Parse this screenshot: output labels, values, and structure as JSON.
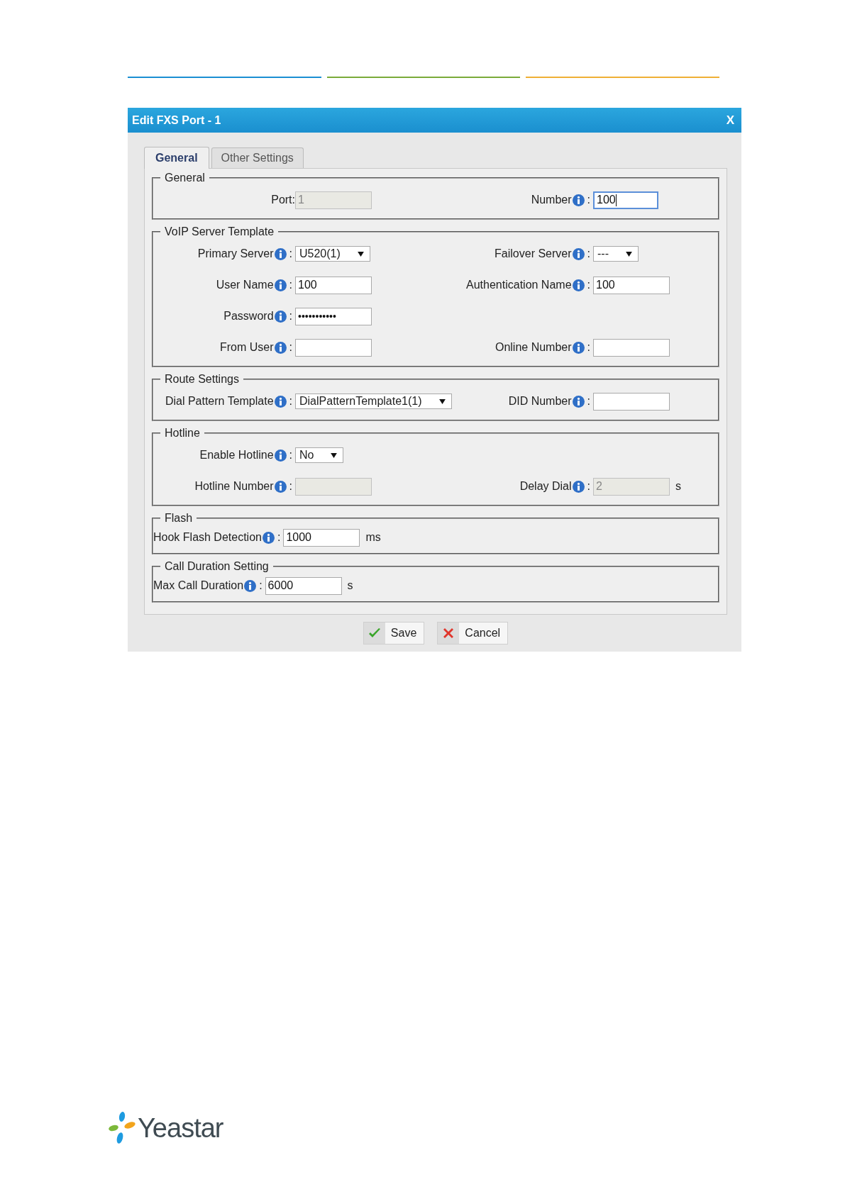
{
  "header_rules": [
    {
      "color": "#1b8fd2"
    },
    {
      "color": "#7aab3a"
    },
    {
      "color": "#efb035"
    }
  ],
  "dialog": {
    "title": "Edit FXS Port - 1",
    "close": "X",
    "tabs": [
      {
        "label": "General",
        "selected": true
      },
      {
        "label": "Other Settings",
        "selected": false
      }
    ],
    "sections": [
      {
        "title": "General",
        "compact": false,
        "rows": [
          [
            {
              "label": "Port:",
              "info": false,
              "kind": "input",
              "value": "1",
              "disabled": true,
              "focused": false
            },
            {
              "label": "Number",
              "info": true,
              "sep": ":",
              "kind": "input",
              "value": "100",
              "disabled": false,
              "focused": true
            }
          ]
        ]
      },
      {
        "title": "VoIP Server Template",
        "compact": false,
        "rows": [
          [
            {
              "label": "Primary Server",
              "info": true,
              "sep": ":",
              "kind": "select",
              "value": "U520(1)",
              "disabled": false,
              "focused": false
            },
            {
              "label": "Failover Server",
              "info": true,
              "sep": ":",
              "kind": "select",
              "value": "---",
              "disabled": false,
              "focused": false
            }
          ],
          [
            {
              "label": "User Name",
              "info": true,
              "sep": ":",
              "kind": "input",
              "value": "100",
              "disabled": false,
              "focused": false
            },
            {
              "label": "Authentication Name",
              "info": true,
              "sep": ":",
              "kind": "input",
              "value": "100",
              "disabled": false,
              "focused": false
            }
          ],
          [
            {
              "label": "Password",
              "info": true,
              "sep": ":",
              "kind": "password",
              "value": "•••••••••••",
              "disabled": false,
              "focused": false
            }
          ],
          [
            {
              "label": "From User",
              "info": true,
              "sep": ":",
              "kind": "input",
              "disabled": false,
              "focused": false
            },
            {
              "label": "Online Number",
              "info": true,
              "sep": ":",
              "kind": "input",
              "disabled": false,
              "focused": false
            }
          ]
        ]
      },
      {
        "title": "Route Settings",
        "compact": false,
        "rows": [
          [
            {
              "label": "Dial Pattern Template",
              "info": true,
              "sep": ":",
              "kind": "select",
              "value": "DialPatternTemplate1(1)",
              "disabled": false,
              "focused": false
            },
            {
              "label": "DID Number",
              "info": true,
              "sep": ":",
              "kind": "input",
              "disabled": false,
              "focused": false
            }
          ]
        ]
      },
      {
        "title": "Hotline",
        "compact": false,
        "rows": [
          [
            {
              "label": "Enable Hotline",
              "info": true,
              "sep": ":",
              "kind": "select",
              "value": "No",
              "disabled": false,
              "focused": false
            }
          ],
          [
            {
              "label": "Hotline Number",
              "info": true,
              "sep": ":",
              "kind": "input",
              "disabled": true,
              "focused": false
            },
            {
              "label": "Delay Dial",
              "info": true,
              "sep": ":",
              "kind": "input",
              "value": "2",
              "unit": "s",
              "disabled": true,
              "focused": false
            }
          ]
        ]
      },
      {
        "title": "Flash",
        "compact": true,
        "rows": [
          [
            {
              "label": "Hook Flash Detection",
              "info": true,
              "sep": ":",
              "kind": "input",
              "value": "1000",
              "unit": "ms",
              "disabled": false,
              "focused": false
            }
          ]
        ]
      },
      {
        "title": "Call Duration Setting",
        "compact": true,
        "rows": [
          [
            {
              "label": "Max Call Duration",
              "info": true,
              "sep": ":",
              "kind": "input",
              "value": "6000",
              "unit": "s",
              "disabled": false,
              "focused": false
            }
          ]
        ]
      }
    ],
    "buttons": [
      {
        "label": "Save",
        "kind": "save"
      },
      {
        "label": "Cancel",
        "kind": "cancel"
      }
    ]
  },
  "logo": {
    "text": "Yeastar"
  }
}
